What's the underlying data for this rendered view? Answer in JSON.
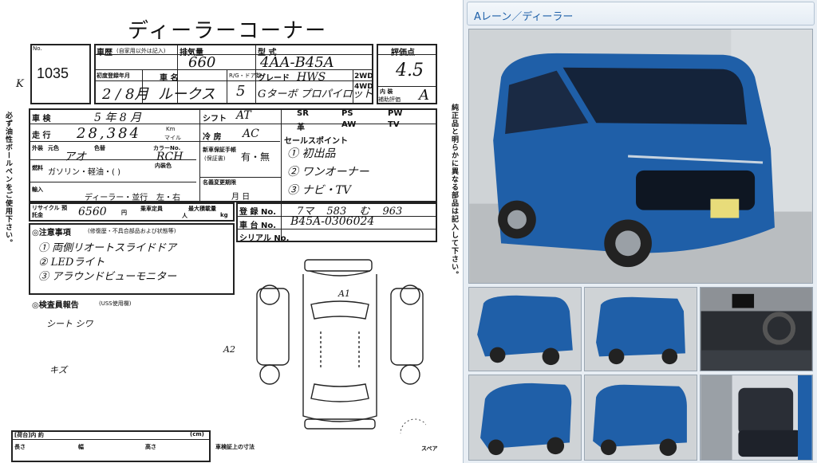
{
  "sheet": {
    "title": "ディーラーコーナー",
    "lot": {
      "no_label": "No.",
      "value": "1035"
    },
    "history_label": "車歴",
    "history_note": "(自家用以外は記入)",
    "displacement_label": "排気量",
    "displacement": "660",
    "model_label": "型 式",
    "model": "4AA-B45A",
    "grade_score_label": "評価点",
    "grade_score": "4.5",
    "interior_label": "内 装",
    "interior_sub": "補助評価",
    "interior_score": "A",
    "first_reg_label": "初度登録年月",
    "first_reg": "2 / 8月",
    "car_name_label": "車 名",
    "car_name": "ルークス",
    "doors_label": "R/G・ドア数",
    "doors": "5",
    "grade_label": "グレード",
    "grade_top": "HWS",
    "grade": "Gターボ プロパイロット",
    "drive_2wd": "2WD",
    "drive_4wd": "4WD",
    "side_k": "K",
    "inspection_label": "車 検",
    "inspection_value": "5 年 8 月",
    "mileage_label": "走 行",
    "mileage": "28,384",
    "mileage_unit_km": "Km",
    "mileage_unit_mile": "マイル",
    "shift_label": "シフト",
    "shift": "AT",
    "ac_label": "冷 房",
    "ac": "AC",
    "equip_row1": [
      "SR",
      "PS",
      "PW"
    ],
    "equip_row2": [
      "革",
      "AW",
      "TV"
    ],
    "exterior_color_label": "外装",
    "color_label": "元色",
    "color_tone_label": "色替",
    "color_value": "アオ",
    "color_code_label": "カラーNo.",
    "color_code": "RCH",
    "interior_color_label": "内装色",
    "fuel_label": "燃料",
    "fuel_value": "ガソリン・軽油・(  )",
    "warranty_label": "新車保証手帳",
    "warranty_note": "(保証書)",
    "warranty_value": "有・無",
    "import_label": "輸入",
    "import_value": "ディーラー・並行",
    "steering_value": "左・右",
    "recycle_label": "リサイクル 預託金",
    "recycle_value": "6560",
    "recycle_unit": "円",
    "capacity_label": "乗車定員",
    "capacity_unit": "人",
    "load_label": "最大積載量",
    "load_unit": "kg",
    "name_change_label": "名義変更期限",
    "name_change_value": "月  日",
    "sales_points_label": "セールスポイント",
    "sales_points": [
      "① 初出品",
      "② ワンオーナー",
      "③ ナビ・TV"
    ],
    "reg_no_label": "登 録 No.",
    "reg_no": "7マ 583 む 963",
    "chassis_label": "車 台 No.",
    "chassis": "B45A-0306024",
    "serial_label": "シリアル No.",
    "notes_label": "◎注意事項",
    "notes_sub": "(修復歴・不具合部品および状態等)",
    "notes": [
      "① 両側リオートスライドドア",
      "② LEDライト",
      "③ アラウンドビューモニター"
    ],
    "inspector_label": "◎検査員報告",
    "inspector_sub": "(USS使用欄)",
    "inspector_notes": [
      "シート シワ",
      "キズ"
    ],
    "damage_marks": [
      "A1",
      "A2"
    ],
    "cargo_label": "[荷台]内 約",
    "cargo_dims": [
      "長さ",
      "幅",
      "高さ"
    ],
    "cargo_unit": "(cm)",
    "spare_label": "スペア",
    "cert_label": "車検証上の寸法",
    "left_margin": "必ず油性ボールペンをご使用下さい。",
    "right_margin": "純正品と明らかに異なる部品は記入して下さい。"
  },
  "panel": {
    "header": "Aレーン／ディーラー",
    "car_color": "#1f5fa8",
    "photos": [
      "main-photo",
      "thumb-front-left",
      "thumb-rear-left",
      "thumb-cockpit",
      "thumb-front-right",
      "thumb-rear-right",
      "thumb-rear-seat"
    ]
  }
}
